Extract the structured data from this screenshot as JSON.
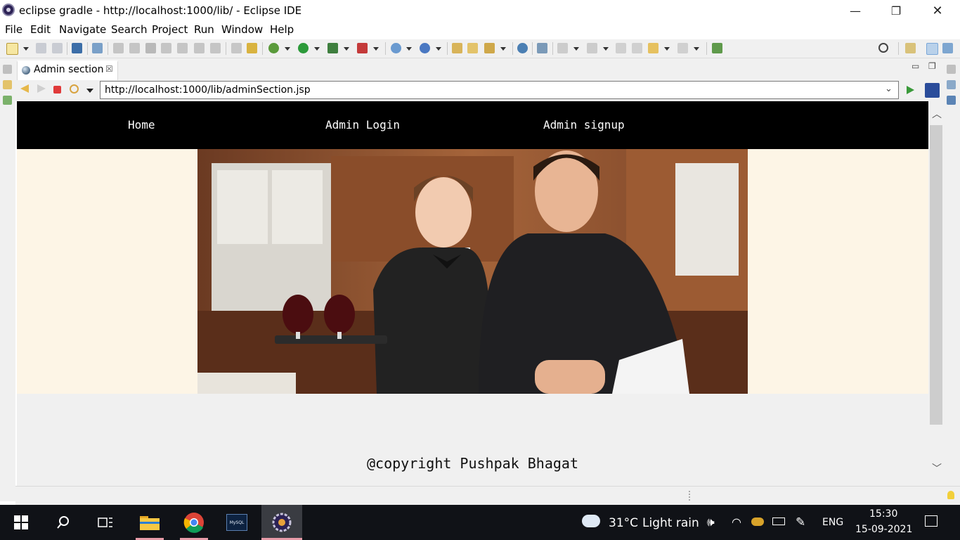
{
  "window": {
    "title": "eclipse gradle - http://localhost:1000/lib/ - Eclipse IDE",
    "minimize_glyph": "—",
    "maximize_glyph": "❐",
    "close_glyph": "✕"
  },
  "menu": {
    "items": [
      "File",
      "Edit",
      "Navigate",
      "Search",
      "Project",
      "Run",
      "Window",
      "Help"
    ]
  },
  "editor": {
    "tab_label": "Admin section",
    "tab_close_glyph": "☒"
  },
  "browser": {
    "url": "http://localhost:1000/lib/adminSection.jsp"
  },
  "site": {
    "nav_links": [
      "Home",
      "Admin Login",
      "Admin signup"
    ],
    "hero_image": "waiter-and-waitress-with-wine-glasses",
    "copyright": "@copyright Pushpak Bhagat",
    "colors": {
      "nav_bg": "#000000",
      "banner_bg": "#fdf5e6",
      "page_bg": "#f0f0f0"
    }
  },
  "taskbar": {
    "apps": [
      "windows-start",
      "search",
      "task-view",
      "file-explorer",
      "chrome",
      "mysql",
      "eclipse"
    ],
    "mysql_label": "MySQL",
    "weather_temp": "31°C",
    "weather_desc": "Light rain",
    "language": "ENG",
    "time": "15:30",
    "date": "15-09-2021"
  }
}
